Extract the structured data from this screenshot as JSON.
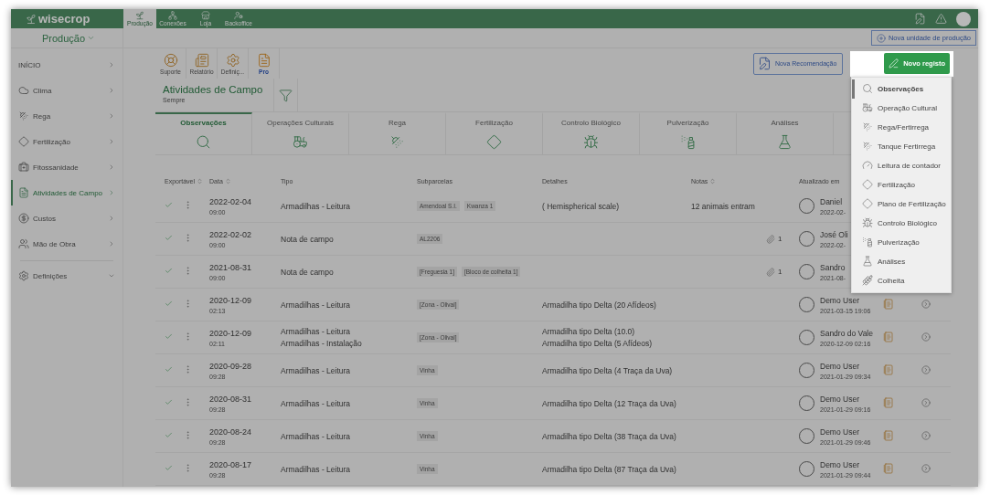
{
  "topbar": {
    "logo": "wisecrop",
    "apps": [
      {
        "label": "Produção",
        "selected": true
      },
      {
        "label": "Conexões",
        "selected": false
      },
      {
        "label": "Loja",
        "selected": false
      },
      {
        "label": "Backoffice",
        "selected": false
      }
    ]
  },
  "subheader": {
    "unit": "Produção",
    "new_unit_button": "Nova unidade de produção"
  },
  "sidebar": {
    "items": [
      {
        "label": "INÍCIO",
        "kind": "section",
        "selected": false
      },
      {
        "label": "Clima",
        "kind": "link",
        "selected": false
      },
      {
        "label": "Rega",
        "kind": "link",
        "selected": false
      },
      {
        "label": "Fertilização",
        "kind": "link",
        "selected": false
      },
      {
        "label": "Fitossanidade",
        "kind": "link",
        "selected": false
      },
      {
        "label": "Atividades de Campo",
        "kind": "link",
        "selected": true
      },
      {
        "label": "Custos",
        "kind": "link",
        "selected": false
      },
      {
        "label": "Mão de Obra",
        "kind": "link",
        "selected": false
      },
      {
        "label": "Definições",
        "kind": "group",
        "selected": false
      }
    ]
  },
  "toolbar": {
    "shortcuts": [
      {
        "label": "Suporte",
        "kind": "link"
      },
      {
        "label": "Relatório",
        "kind": "link"
      },
      {
        "label": "Definiç...",
        "kind": "link"
      },
      {
        "label": "Pro",
        "kind": "pro"
      }
    ],
    "recommend_button": "Nova Recomendação",
    "new_record_button": "Novo registo"
  },
  "panel": {
    "title": "Atividades de Campo",
    "period": "Sempre",
    "tabs": [
      {
        "label": "Observações",
        "selected": true
      },
      {
        "label": "Operações Culturais",
        "selected": false
      },
      {
        "label": "Rega",
        "selected": false
      },
      {
        "label": "Fertilização",
        "selected": false
      },
      {
        "label": "Controlo Biológico",
        "selected": false
      },
      {
        "label": "Pulverização",
        "selected": false
      },
      {
        "label": "Análises",
        "selected": false
      }
    ],
    "table": {
      "columns": [
        {
          "label": "Exportável",
          "sortable": true
        },
        {
          "label": "Data",
          "sortable": true
        },
        {
          "label": "Tipo",
          "sortable": false
        },
        {
          "label": "Subparcelas",
          "sortable": false
        },
        {
          "label": "Detalhes",
          "sortable": false
        },
        {
          "label": "Notas",
          "sortable": true
        },
        {
          "label": "Atualizado em",
          "sortable": false
        }
      ],
      "rows": [
        {
          "exportable": true,
          "date": "2022-02-04",
          "time": "09:00",
          "types": [
            "Armadilhas - Leitura"
          ],
          "plots": [
            "Amendoal S.I.",
            "Kwanza 1"
          ],
          "details": [
            "( Hemispherical scale)"
          ],
          "notes": "12 animais entram",
          "user": "Daniel",
          "updated_date": "2022-02-"
        },
        {
          "exportable": true,
          "date": "2022-02-02",
          "time": "09:00",
          "types": [
            "Nota de campo"
          ],
          "plots": [
            "AL2206"
          ],
          "attachments": "1",
          "user": "José Oli",
          "updated_date": "2022-02-"
        },
        {
          "exportable": true,
          "date": "2021-08-31",
          "time": "09:00",
          "types": [
            "Nota de campo"
          ],
          "plots": [
            "[Freguesia 1]",
            "[Bloco de colheita 1]"
          ],
          "attachments": "1",
          "user": "Sandro",
          "updated_date": "2021-08-"
        },
        {
          "exportable": true,
          "date": "2020-12-09",
          "time": "02:13",
          "types": [
            "Armadilhas - Leitura"
          ],
          "plots": [
            "[Zona - Olival]"
          ],
          "details": [
            "Armadilha tipo Delta (20 Afídeos)"
          ],
          "user": "Demo User",
          "updated_date": "2021-03-15",
          "updated_time": "19:06"
        },
        {
          "exportable": true,
          "date": "2020-12-09",
          "time": "02:11",
          "types": [
            "Armadilhas - Leitura",
            "Armadilhas - Instalação"
          ],
          "plots": [
            "[Zona - Olival]"
          ],
          "details": [
            "Armadilha tipo Delta (10.0)",
            "Armadilha tipo Delta (5 Afídeos)"
          ],
          "user": "Sandro do Vale",
          "updated_date": "2020-12-09",
          "updated_time": "02:16"
        },
        {
          "exportable": true,
          "date": "2020-09-28",
          "time": "09:28",
          "types": [
            "Armadilhas - Leitura"
          ],
          "plots": [
            "Vinha"
          ],
          "details": [
            "Armadilha tipo Delta (4 Traça da Uva)"
          ],
          "user": "Demo User",
          "updated_date": "2021-01-29",
          "updated_time": "09:34"
        },
        {
          "exportable": true,
          "date": "2020-08-31",
          "time": "09:28",
          "types": [
            "Armadilhas - Leitura"
          ],
          "plots": [
            "Vinha"
          ],
          "details": [
            "Armadilha tipo Delta (12 Traça da Uva)"
          ],
          "user": "Demo User",
          "updated_date": "2021-01-29",
          "updated_time": "09:16"
        },
        {
          "exportable": true,
          "date": "2020-08-24",
          "time": "09:28",
          "types": [
            "Armadilhas - Leitura"
          ],
          "plots": [
            "Vinha"
          ],
          "details": [
            "Armadilha tipo Delta (38 Traça da Uva)"
          ],
          "user": "Demo User",
          "updated_date": "2021-01-29",
          "updated_time": "09:46"
        },
        {
          "exportable": true,
          "date": "2020-08-17",
          "time": "09:28",
          "types": [
            "Armadilhas - Leitura"
          ],
          "plots": [
            "Vinha"
          ],
          "details": [
            "Armadilha tipo Delta (87 Traça da Uva)"
          ],
          "user": "Demo User",
          "updated_date": "2021-01-29",
          "updated_time": "09:44"
        }
      ]
    }
  },
  "dropdown": {
    "items": [
      {
        "label": "Observações",
        "selected": true
      },
      {
        "label": "Operação Cultural",
        "selected": false
      },
      {
        "label": "Rega/Fertirrega",
        "selected": false
      },
      {
        "label": "Tanque Fertirrega",
        "selected": false
      },
      {
        "label": "Leitura de contador",
        "selected": false
      },
      {
        "label": "Fertilização",
        "selected": false
      },
      {
        "label": "Plano de Fertilização",
        "selected": false
      },
      {
        "label": "Controlo Biológico",
        "selected": false
      },
      {
        "label": "Pulverização",
        "selected": false
      },
      {
        "label": "Análises",
        "selected": false
      },
      {
        "label": "Colheita",
        "selected": false
      }
    ]
  }
}
